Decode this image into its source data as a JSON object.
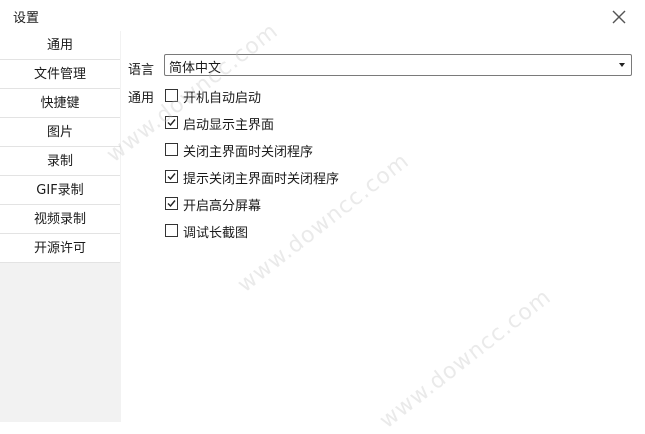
{
  "window": {
    "title": "设置",
    "close_icon": "close-icon"
  },
  "sidebar": {
    "items": [
      {
        "label": "通用"
      },
      {
        "label": "文件管理"
      },
      {
        "label": "快捷键"
      },
      {
        "label": "图片"
      },
      {
        "label": "录制"
      },
      {
        "label": "GIF录制"
      },
      {
        "label": "视频录制"
      },
      {
        "label": "开源许可"
      }
    ],
    "selected_index": 0
  },
  "content": {
    "language_label": "语言",
    "language_value": "简体中文",
    "general_label": "通用",
    "options": [
      {
        "label": "开机自动启动",
        "checked": false
      },
      {
        "label": "启动显示主界面",
        "checked": true
      },
      {
        "label": "关闭主界面时关闭程序",
        "checked": false
      },
      {
        "label": "提示关闭主界面时关闭程序",
        "checked": true
      },
      {
        "label": "开启高分屏幕",
        "checked": true
      },
      {
        "label": "调试长截图",
        "checked": false
      }
    ]
  },
  "watermark": {
    "text": "www.downcc.com"
  },
  "colors": {
    "sidebar_bg": "#f2f2f2",
    "border": "#7a7a7a",
    "text": "#1a1a1a"
  }
}
